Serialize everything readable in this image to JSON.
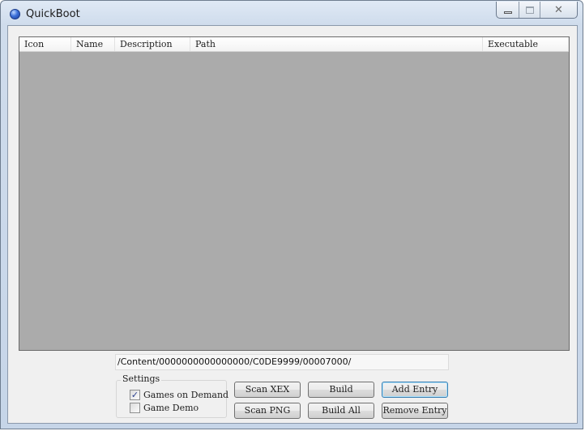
{
  "window": {
    "title": "QuickBoot"
  },
  "listview": {
    "columns": [
      "Icon",
      "Name",
      "Description",
      "Path",
      "Executable"
    ],
    "rows": []
  },
  "path": {
    "value": "/Content/0000000000000000/C0DE9999/00007000/"
  },
  "settings": {
    "label": "Settings",
    "games_on_demand": {
      "label": "Games on Demand",
      "checked": true
    },
    "game_demo": {
      "label": "Game Demo",
      "checked": false
    }
  },
  "buttons": {
    "scan_xex": "Scan XEX",
    "scan_png": "Scan PNG",
    "build": "Build",
    "build_all": "Build All",
    "add_entry": "Add Entry",
    "remove_entry": "Remove Entry"
  },
  "icons": {
    "app": "blue-orb-icon",
    "minimize": "minimize-icon",
    "maximize": "maximize-icon",
    "close": "close-icon",
    "check": "✓"
  },
  "colors": {
    "list_background": "#ababab",
    "dialog_background": "#f0f0f0",
    "default_button_border": "#3c7fb1"
  }
}
